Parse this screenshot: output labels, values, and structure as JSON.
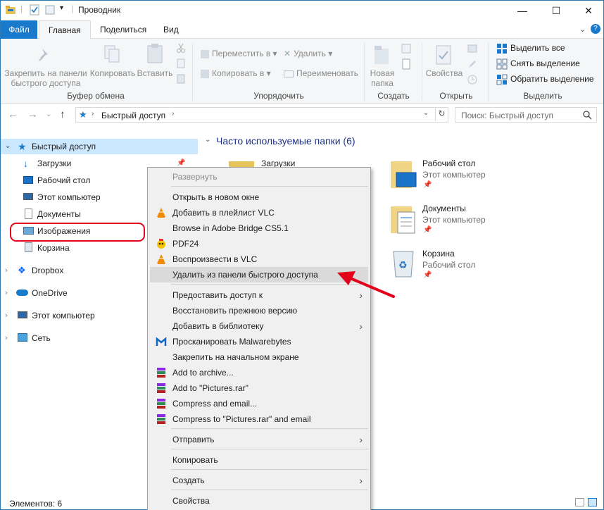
{
  "window": {
    "title": "Проводник",
    "controls": {
      "minimize": "—",
      "maximize": "☐",
      "close": "✕"
    }
  },
  "tabs": [
    {
      "label": "Файл"
    },
    {
      "label": "Главная"
    },
    {
      "label": "Поделиться"
    },
    {
      "label": "Вид"
    }
  ],
  "ribbon": {
    "groups": {
      "clipboard": "Буфер обмена",
      "organize": "Упорядочить",
      "create": "Создать",
      "open": "Открыть",
      "select": "Выделить"
    },
    "pin_line1": "Закрепить на панели",
    "pin_line2": "быстрого доступа",
    "copy": "Копировать",
    "paste": "Вставить",
    "move_to": "Переместить в ▾",
    "copy_to": "Копировать в ▾",
    "delete": "Удалить ▾",
    "rename": "Переименовать",
    "new_folder_line1": "Новая",
    "new_folder_line2": "папка",
    "properties": "Свойства",
    "select_all": "Выделить все",
    "select_none": "Снять выделение",
    "invert_selection": "Обратить выделение"
  },
  "address": {
    "path": "Быстрый доступ",
    "search_placeholder": "Поиск: Быстрый доступ"
  },
  "nav": {
    "quick_access": "Быстрый доступ",
    "items": [
      {
        "label": "Загрузки"
      },
      {
        "label": "Рабочий стол"
      },
      {
        "label": "Этот компьютер"
      },
      {
        "label": "Документы"
      },
      {
        "label": "Изображения"
      },
      {
        "label": "Корзина"
      }
    ],
    "roots": [
      {
        "label": "Dropbox"
      },
      {
        "label": "OneDrive"
      },
      {
        "label": "Этот компьютер"
      },
      {
        "label": "Сеть"
      }
    ]
  },
  "content": {
    "section_title": "Часто используемые папки (6)",
    "folders": [
      {
        "name": "Загрузки",
        "location": ""
      },
      {
        "name": "Рабочий стол",
        "location": "Этот компьютер"
      },
      {
        "name": "Документы",
        "location": "Этот компьютер"
      },
      {
        "name": "Корзина",
        "location": "Рабочий стол"
      }
    ]
  },
  "status": {
    "items_count": "Элементов: 6"
  },
  "context_menu": {
    "items": [
      {
        "label": "Развернуть"
      },
      {
        "label": "Открыть в новом окне"
      },
      {
        "label": "Добавить в плейлист VLC"
      },
      {
        "label": "Browse in Adobe Bridge CS5.1"
      },
      {
        "label": "PDF24"
      },
      {
        "label": "Воспроизвести в VLC"
      },
      {
        "label": "Удалить из панели быстрого доступа"
      },
      {
        "label": "Предоставить доступ к"
      },
      {
        "label": "Восстановить прежнюю версию"
      },
      {
        "label": "Добавить в библиотеку"
      },
      {
        "label": "Просканировать Malwarebytes"
      },
      {
        "label": "Закрепить на начальном экране"
      },
      {
        "label": "Add to archive..."
      },
      {
        "label": "Add to \"Pictures.rar\""
      },
      {
        "label": "Compress and email..."
      },
      {
        "label": "Compress to \"Pictures.rar\" and email"
      },
      {
        "label": "Отправить"
      },
      {
        "label": "Копировать"
      },
      {
        "label": "Создать"
      },
      {
        "label": "Свойства"
      }
    ]
  },
  "colors": {
    "accent": "#1979ca",
    "selection": "#cce8ff",
    "annotation": "#e2001a"
  }
}
